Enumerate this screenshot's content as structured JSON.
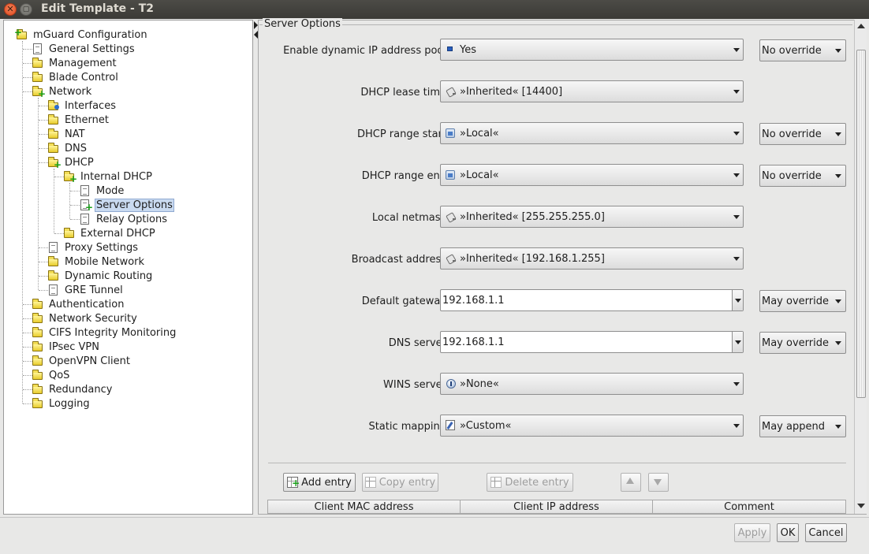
{
  "window": {
    "title": "Edit Template - T2",
    "close_glyph": "✕",
    "min_glyph": "▢"
  },
  "tree": {
    "items": [
      {
        "label": "mGuard Configuration",
        "icon": "folder-plus-icon"
      },
      {
        "label": "General Settings",
        "icon": "document-icon"
      },
      {
        "label": "Management",
        "icon": "folder-icon"
      },
      {
        "label": "Blade Control",
        "icon": "folder-icon"
      },
      {
        "label": "Network",
        "icon": "folder-plus-icon"
      },
      {
        "label": "Interfaces",
        "icon": "folder-dot-icon"
      },
      {
        "label": "Ethernet",
        "icon": "folder-icon"
      },
      {
        "label": "NAT",
        "icon": "folder-icon"
      },
      {
        "label": "DNS",
        "icon": "folder-icon"
      },
      {
        "label": "DHCP",
        "icon": "folder-plus-icon"
      },
      {
        "label": "Internal DHCP",
        "icon": "folder-plus-icon"
      },
      {
        "label": "Mode",
        "icon": "document-icon"
      },
      {
        "label": "Server Options",
        "icon": "document-plus-icon",
        "selected": true
      },
      {
        "label": "Relay Options",
        "icon": "document-icon"
      },
      {
        "label": "External DHCP",
        "icon": "folder-icon"
      },
      {
        "label": "Proxy Settings",
        "icon": "document-icon"
      },
      {
        "label": "Mobile Network",
        "icon": "folder-icon"
      },
      {
        "label": "Dynamic Routing",
        "icon": "folder-icon"
      },
      {
        "label": "GRE Tunnel",
        "icon": "document-icon"
      },
      {
        "label": "Authentication",
        "icon": "folder-icon"
      },
      {
        "label": "Network Security",
        "icon": "folder-icon"
      },
      {
        "label": "CIFS Integrity Monitoring",
        "icon": "folder-icon"
      },
      {
        "label": "IPsec VPN",
        "icon": "folder-icon"
      },
      {
        "label": "OpenVPN Client",
        "icon": "folder-icon"
      },
      {
        "label": "QoS",
        "icon": "folder-icon"
      },
      {
        "label": "Redundancy",
        "icon": "folder-icon"
      },
      {
        "label": "Logging",
        "icon": "folder-icon"
      }
    ]
  },
  "section": {
    "title": "Server Options"
  },
  "fields": [
    {
      "label": "Enable dynamic IP address pool",
      "value": "Yes",
      "icon": "blue-square-icon",
      "override": "No override"
    },
    {
      "label": "DHCP lease time",
      "value": "»Inherited« [14400]",
      "icon": "inherited-icon",
      "override": ""
    },
    {
      "label": "DHCP range start",
      "value": "»Local«",
      "icon": "local-icon",
      "override": "No override"
    },
    {
      "label": "DHCP range end",
      "value": "»Local«",
      "icon": "local-icon",
      "override": "No override"
    },
    {
      "label": "Local netmask",
      "value": "»Inherited« [255.255.255.0]",
      "icon": "inherited-icon",
      "override": ""
    },
    {
      "label": "Broadcast address",
      "value": "»Inherited« [192.168.1.255]",
      "icon": "inherited-icon",
      "override": ""
    },
    {
      "label": "Default gateway",
      "value": "192.168.1.1",
      "icon": "",
      "override": "May override"
    },
    {
      "label": "DNS server",
      "value": "192.168.1.1",
      "icon": "",
      "override": "May override"
    },
    {
      "label": "WINS server",
      "value": "»None«",
      "icon": "none-icon",
      "override": ""
    },
    {
      "label": "Static mapping",
      "value": "»Custom«",
      "icon": "custom-icon",
      "override": "May append"
    }
  ],
  "toolbar": {
    "add_entry": "Add entry",
    "copy_entry": "Copy entry",
    "delete_entry": "Delete entry"
  },
  "table": {
    "columns": [
      "Client MAC address",
      "Client IP address",
      "Comment"
    ]
  },
  "footer": {
    "apply": "Apply",
    "ok": "OK",
    "cancel": "Cancel"
  }
}
